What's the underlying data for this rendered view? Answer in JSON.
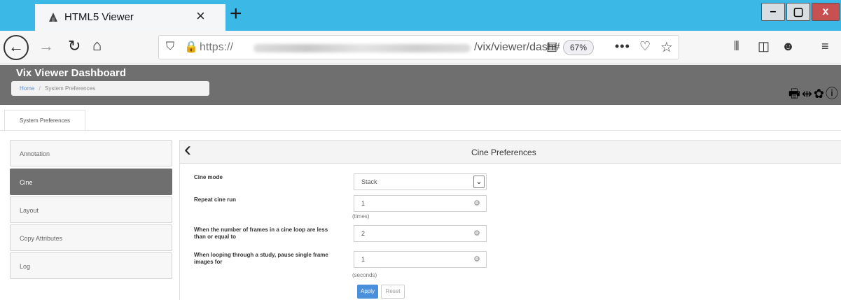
{
  "browser": {
    "tab_title": "HTML5 Viewer",
    "url_prefix": "https://",
    "url_path": "/vix/viewer/dash#",
    "zoom": "67%"
  },
  "app": {
    "title": "Vix Viewer Dashboard",
    "breadcrumb": {
      "home": "Home",
      "separator": "/",
      "current": "System Preferences"
    }
  },
  "page_tabs": [
    "System Preferences"
  ],
  "sidebar": {
    "items": [
      {
        "label": "Annotation"
      },
      {
        "label": "Cine",
        "active": true
      },
      {
        "label": "Layout"
      },
      {
        "label": "Copy Attributes"
      },
      {
        "label": "Log"
      }
    ]
  },
  "panel": {
    "title": "Cine Preferences",
    "fields": [
      {
        "label": "Cine mode",
        "value": "Stack"
      },
      {
        "label": "Repeat cine run",
        "value": "1",
        "unit": "(times)"
      },
      {
        "label": "When the number of frames in a cine loop are less than or equal to",
        "value": "2"
      },
      {
        "label": "When looping through a study, pause single frame images for",
        "value": "1",
        "unit": "(seconds)"
      }
    ],
    "apply_label": "Apply",
    "reset_label": "Reset"
  }
}
